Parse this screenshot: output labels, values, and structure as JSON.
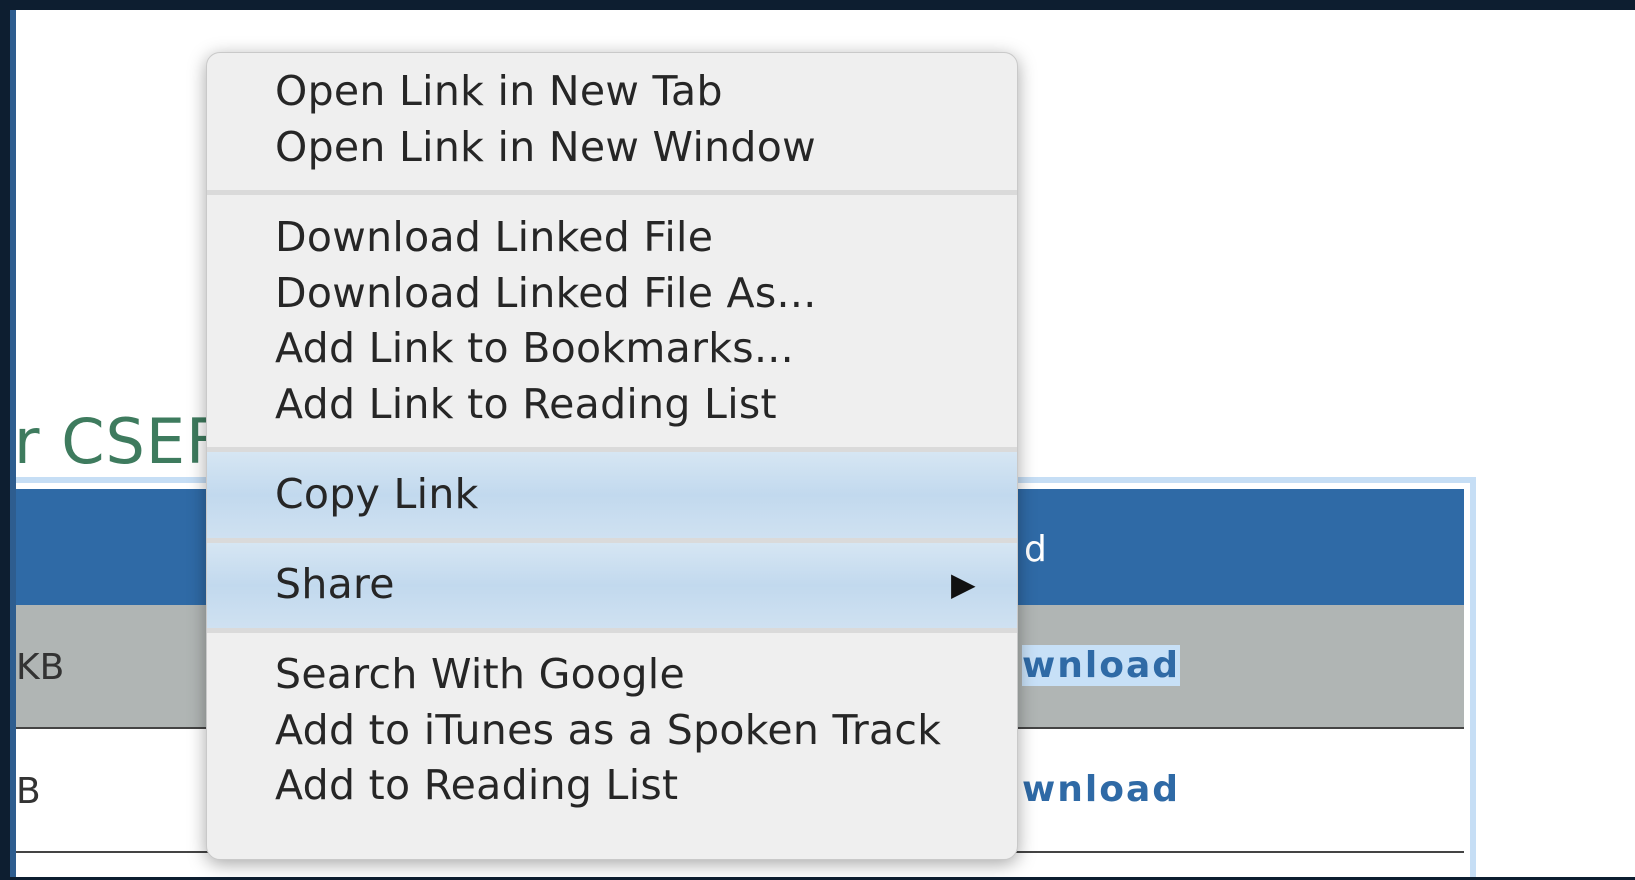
{
  "background_page": {
    "heading_fragment": "r CSEF",
    "table": {
      "header_fragment": "d",
      "rows": [
        {
          "size_fragment": "KB",
          "download_fragment": "wnload"
        },
        {
          "size_fragment": "B",
          "download_fragment": "wnload"
        }
      ]
    }
  },
  "context_menu": {
    "groups": [
      {
        "items": [
          "Open Link in New Tab",
          "Open Link in New Window"
        ]
      },
      {
        "items": [
          "Download Linked File",
          "Download Linked File As...",
          "Add Link to Bookmarks...",
          "Add Link to Reading List"
        ]
      },
      {
        "items": [
          "Copy Link"
        ]
      },
      {
        "items": [
          "Share"
        ],
        "submenu_icon": "triangle-right-icon"
      },
      {
        "items": [
          "Search With Google",
          "Add to iTunes as a Spoken Track",
          "Add to Reading List"
        ]
      }
    ]
  },
  "colors": {
    "table_header": "#2f6aa6",
    "heading": "#3e7b5e",
    "link": "#2f6aa6",
    "menu_bg": "#efefef"
  }
}
